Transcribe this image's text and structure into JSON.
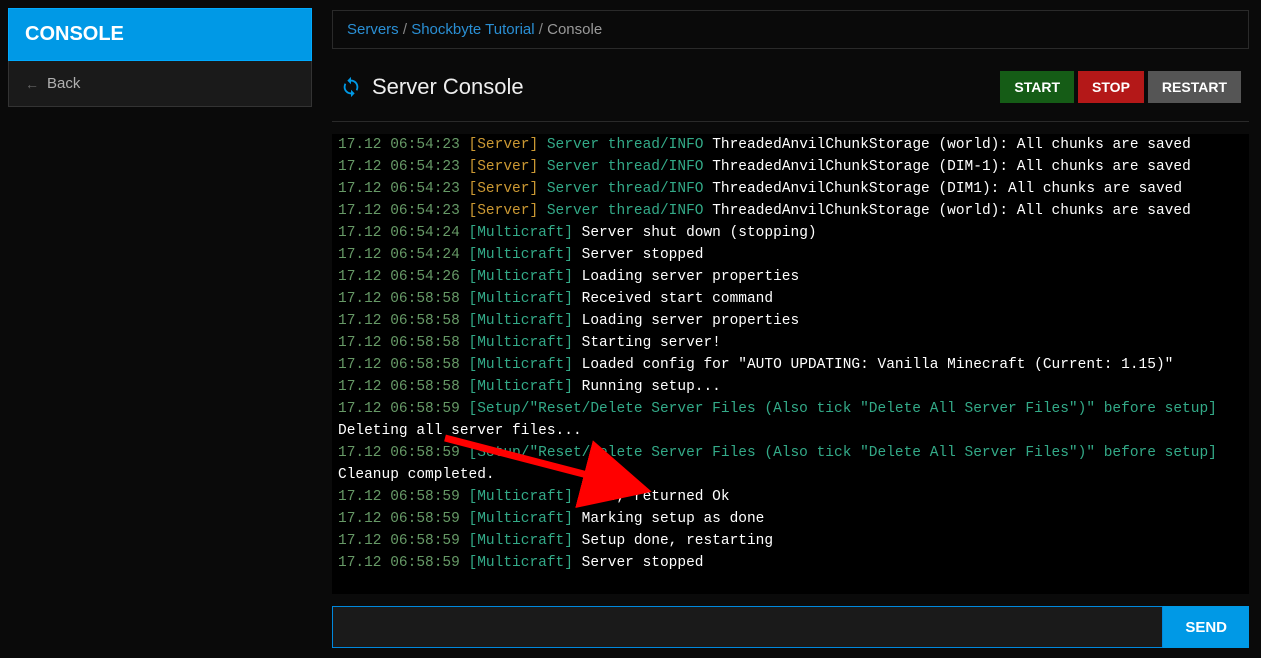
{
  "sidebar": {
    "header": "CONSOLE",
    "back_label": "Back"
  },
  "breadcrumb": {
    "item1": "Servers",
    "item2": "Shockbyte Tutorial",
    "item3": "Console",
    "sep": " / "
  },
  "page": {
    "title": "Server Console"
  },
  "buttons": {
    "start": "START",
    "stop": "STOP",
    "restart": "RESTART",
    "send": "SEND"
  },
  "console_lines": [
    {
      "time": "17.12 06:54:23",
      "tag": "[Server]",
      "tagClass": "c-server",
      "thread": "Server thread/INFO",
      "msg": "ThreadedAnvilChunkStorage (world): All chunks are saved"
    },
    {
      "time": "17.12 06:54:23",
      "tag": "[Server]",
      "tagClass": "c-server",
      "thread": "Server thread/INFO",
      "msg": "ThreadedAnvilChunkStorage (DIM-1): All chunks are saved"
    },
    {
      "time": "17.12 06:54:23",
      "tag": "[Server]",
      "tagClass": "c-server",
      "thread": "Server thread/INFO",
      "msg": "ThreadedAnvilChunkStorage (DIM1): All chunks are saved"
    },
    {
      "time": "17.12 06:54:23",
      "tag": "[Server]",
      "tagClass": "c-server",
      "thread": "Server thread/INFO",
      "msg": "ThreadedAnvilChunkStorage (world): All chunks are saved"
    },
    {
      "time": "17.12 06:54:24",
      "tag": "[Multicraft]",
      "tagClass": "c-multi",
      "thread": "",
      "msg": "Server shut down (stopping)"
    },
    {
      "time": "17.12 06:54:24",
      "tag": "[Multicraft]",
      "tagClass": "c-multi",
      "thread": "",
      "msg": "Server stopped"
    },
    {
      "time": "17.12 06:54:26",
      "tag": "[Multicraft]",
      "tagClass": "c-multi",
      "thread": "",
      "msg": "Loading server properties"
    },
    {
      "time": "17.12 06:58:58",
      "tag": "[Multicraft]",
      "tagClass": "c-multi",
      "thread": "",
      "msg": "Received start command"
    },
    {
      "time": "17.12 06:58:58",
      "tag": "[Multicraft]",
      "tagClass": "c-multi",
      "thread": "",
      "msg": "Loading server properties"
    },
    {
      "time": "17.12 06:58:58",
      "tag": "[Multicraft]",
      "tagClass": "c-multi",
      "thread": "",
      "msg": "Starting server!"
    },
    {
      "time": "17.12 06:58:58",
      "tag": "[Multicraft]",
      "tagClass": "c-multi",
      "thread": "",
      "msg": "Loaded config for \"AUTO UPDATING: Vanilla Minecraft (Current: 1.15)\""
    },
    {
      "time": "17.12 06:58:58",
      "tag": "[Multicraft]",
      "tagClass": "c-multi",
      "thread": "",
      "msg": "Running setup..."
    },
    {
      "time": "17.12 06:58:59",
      "tag": "[Setup/\"Reset/Delete Server Files (Also tick \"Delete All Server Files\")\" before setup]",
      "tagClass": "c-setup",
      "thread": "",
      "msg": ""
    },
    {
      "time": "",
      "tag": "",
      "tagClass": "",
      "thread": "",
      "msg": "Deleting all server files..."
    },
    {
      "time": "17.12 06:58:59",
      "tag": "[Setup/\"Reset/Delete Server Files (Also tick \"Delete All Server Files\")\" before setup]",
      "tagClass": "c-setup",
      "thread": "",
      "msg": ""
    },
    {
      "time": "",
      "tag": "",
      "tagClass": "",
      "thread": "",
      "msg": "Cleanup completed."
    },
    {
      "time": "17.12 06:58:59",
      "tag": "[Multicraft]",
      "tagClass": "c-multi",
      "thread": "",
      "msg": "Done, returned Ok"
    },
    {
      "time": "17.12 06:58:59",
      "tag": "[Multicraft]",
      "tagClass": "c-multi",
      "thread": "",
      "msg": "Marking setup as done"
    },
    {
      "time": "17.12 06:58:59",
      "tag": "[Multicraft]",
      "tagClass": "c-multi",
      "thread": "",
      "msg": "Setup done, restarting"
    },
    {
      "time": "17.12 06:58:59",
      "tag": "[Multicraft]",
      "tagClass": "c-multi",
      "thread": "",
      "msg": "Server stopped"
    }
  ],
  "cmd_placeholder": ""
}
